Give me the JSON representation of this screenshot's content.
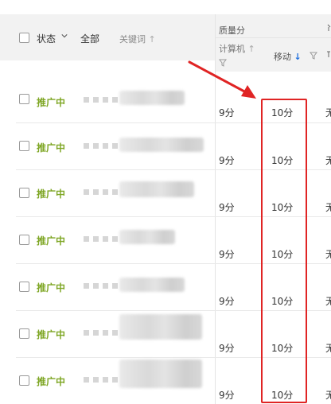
{
  "header": {
    "status_label": "状态",
    "filter_all": "全部",
    "keyword_label": "关键词",
    "keyword_sort_glyph": "↑",
    "quality_label": "质量分",
    "pc_label": "计算机",
    "pc_sort_glyph": "↑",
    "mobile_label": "移动",
    "mobile_sort_glyph": "↓"
  },
  "rows": [
    {
      "status": "推广中",
      "pc_score": "9分",
      "mobile_score": "10分",
      "next_col": "无"
    },
    {
      "status": "推广中",
      "pc_score": "9分",
      "mobile_score": "10分",
      "next_col": "无"
    },
    {
      "status": "推广中",
      "pc_score": "9分",
      "mobile_score": "10分",
      "next_col": "无"
    },
    {
      "status": "推广中",
      "pc_score": "9分",
      "mobile_score": "10分",
      "next_col": "无"
    },
    {
      "status": "推广中",
      "pc_score": "9分",
      "mobile_score": "10分",
      "next_col": "无"
    },
    {
      "status": "推广中",
      "pc_score": "9分",
      "mobile_score": "10分",
      "next_col": "无"
    },
    {
      "status": "推广中",
      "pc_score": "9分",
      "mobile_score": "10分",
      "next_col": "无"
    }
  ],
  "colors": {
    "status_active": "#7ea624",
    "annotation": "#e02424",
    "sort_active": "#1f6fde",
    "header_bg": "#f2f2f2"
  },
  "icons": [
    "checkbox",
    "chevron-down-icon",
    "sort-arrow-icon",
    "filter-icon",
    "annotation-arrow"
  ]
}
